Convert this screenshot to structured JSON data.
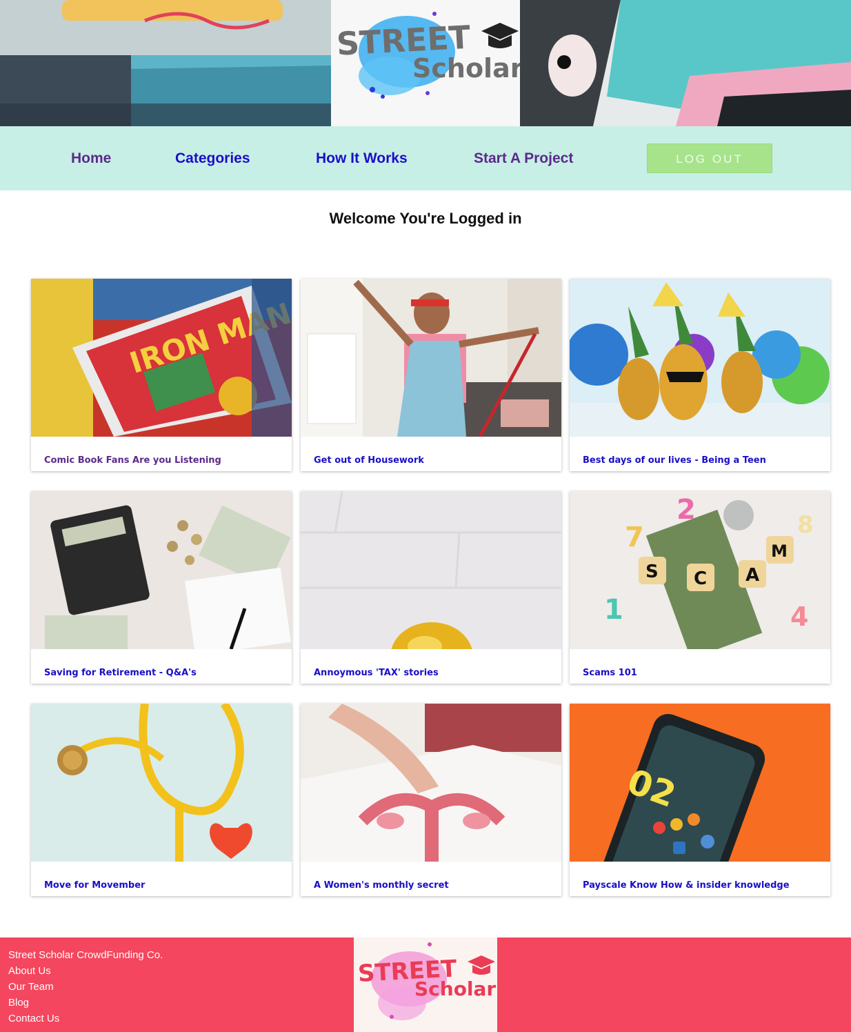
{
  "nav": {
    "home": "Home",
    "categories": "Categories",
    "how_it_works": "How It Works",
    "start_project": "Start A Project",
    "logout": "LOG OUT"
  },
  "welcome": "Welcome You're Logged in",
  "logo": {
    "line1": "STREET",
    "line2": "Scholar"
  },
  "cards": [
    {
      "title": "Comic Book Fans Are you Listening",
      "image": "comic-books"
    },
    {
      "title": "Get out of Housework",
      "image": "man-dancing-mop"
    },
    {
      "title": "Best days of our lives - Being a Teen",
      "image": "party-pineapples"
    },
    {
      "title": "Saving for Retirement - Q&A's",
      "image": "calculator-money"
    },
    {
      "title": "Annoymous 'TAX' stories",
      "image": "gold-piggy-bank"
    },
    {
      "title": "Scams 101",
      "image": "scam-dice"
    },
    {
      "title": "Move for Movember",
      "image": "stethoscope-heart"
    },
    {
      "title": "A Women's monthly secret",
      "image": "anatomy-chart"
    },
    {
      "title": "Payscale Know How & insider knowledge",
      "image": "phone-orange"
    }
  ],
  "footer": {
    "company": "Street Scholar CrowdFunding Co.",
    "about": "About Us",
    "team": "Our Team",
    "blog": "Blog",
    "contact": "Contact Us"
  },
  "colors": {
    "nav_bg": "#c7efe6",
    "link_blue": "#1a0fc7",
    "link_purple": "#5b2a8b",
    "logout_bg": "#a6e38a",
    "footer_bg": "#f4465e"
  }
}
